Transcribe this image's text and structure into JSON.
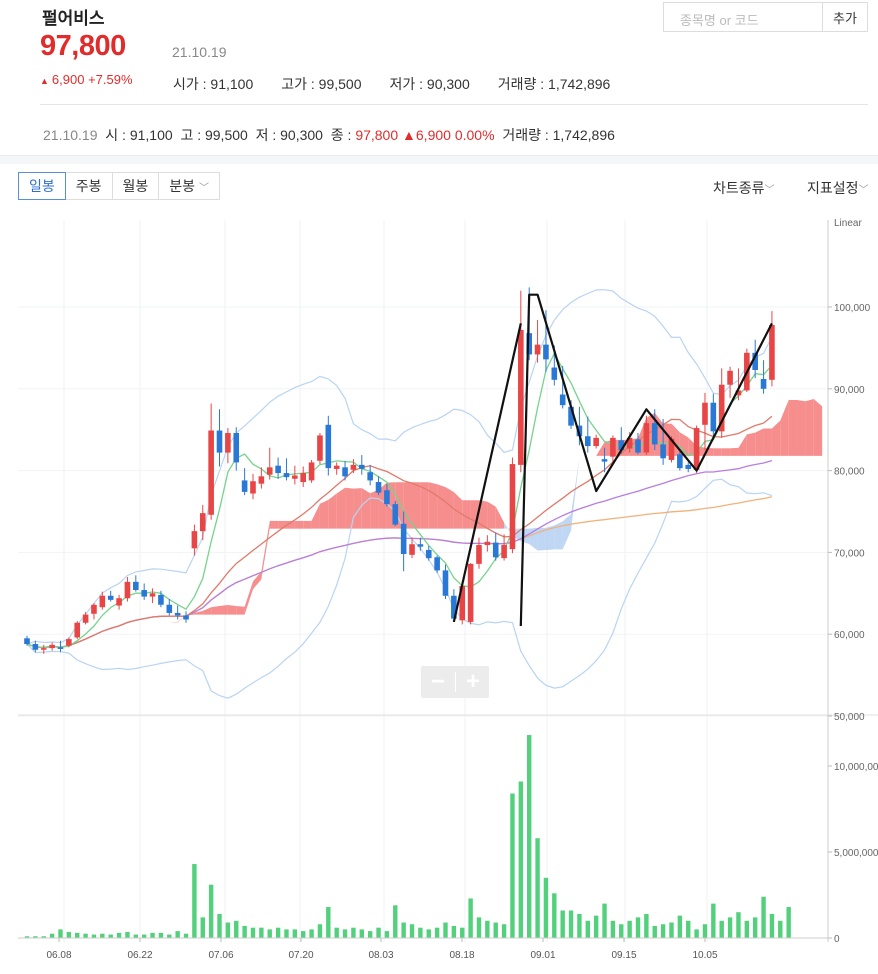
{
  "stock": {
    "name": "펄어비스",
    "price": "97,800",
    "date": "21.10.19",
    "change": "6,900",
    "change_pct": "+7.59%",
    "open_label": "시가 : 91,100",
    "high_label": "고가 : 99,500",
    "low_label": "저가 : 90,300",
    "volume_label": "거래량 : 1,742,896"
  },
  "search": {
    "placeholder": "종목명 or 코드",
    "add_label": "추가"
  },
  "info_line": {
    "date": "21.10.19",
    "open": "시 : 91,100",
    "high": "고 : 99,500",
    "low": "저 : 90,300",
    "close_label": "종 : ",
    "close": "97,800",
    "change": "6,900",
    "change_pct": "0.00%",
    "volume": "거래량 : 1,742,896"
  },
  "tabs": [
    "일봉",
    "주봉",
    "월봉",
    "분봉"
  ],
  "active_tab": "일봉",
  "options": {
    "chart_type": "차트종류",
    "indicator": "지표설정"
  },
  "colors": {
    "up": "#e84646",
    "down": "#2a78d6",
    "volume": "#52d07c",
    "cloud_up": "#f47a7a",
    "cloud_down": "#a9c8f0",
    "ma5": "#76d38c",
    "ma20": "#e07a6a",
    "ma60": "#b77ee0",
    "ma120": "#f0b27a",
    "accent": "#e12c2c"
  },
  "zoom": {
    "minus": "−",
    "plus": "+"
  },
  "chart_data": {
    "type": "candlestick",
    "price_axis": {
      "label": "Linear",
      "ylim": [
        50000,
        103000
      ],
      "ticks": [
        "100,000",
        "90,000",
        "80,000",
        "70,000",
        "60,000",
        "50,000"
      ]
    },
    "volume_axis": {
      "ylim": [
        0,
        13500000
      ],
      "ticks": [
        "10,000,000",
        "5,000,000",
        "0"
      ]
    },
    "x_ticks": [
      "06.08",
      "06.22",
      "07.06",
      "07.20",
      "08.03",
      "08.18",
      "09.01",
      "09.15",
      "10.05"
    ],
    "candles": [
      [
        59500,
        59800,
        58600,
        58800
      ],
      [
        58800,
        59200,
        57800,
        58100
      ],
      [
        58100,
        58700,
        57600,
        58300
      ],
      [
        58300,
        59000,
        58000,
        58700
      ],
      [
        58400,
        59200,
        57800,
        58200
      ],
      [
        58600,
        59600,
        58400,
        59400
      ],
      [
        59600,
        61600,
        59400,
        61400
      ],
      [
        61400,
        62700,
        61200,
        62400
      ],
      [
        62500,
        63800,
        61800,
        63600
      ],
      [
        63300,
        65200,
        63000,
        64700
      ],
      [
        64700,
        65300,
        64000,
        64200
      ],
      [
        63500,
        64800,
        63000,
        64400
      ],
      [
        64400,
        67000,
        64000,
        66400
      ],
      [
        66400,
        67200,
        65200,
        65400
      ],
      [
        65400,
        66200,
        64200,
        64600
      ],
      [
        64600,
        65600,
        63800,
        65000
      ],
      [
        64800,
        65300,
        63300,
        63600
      ],
      [
        63600,
        64300,
        62300,
        62600
      ],
      [
        62600,
        63500,
        61800,
        62300
      ],
      [
        62300,
        62800,
        61400,
        61800
      ],
      [
        70500,
        73400,
        69600,
        72600
      ],
      [
        72600,
        75800,
        71500,
        74800
      ],
      [
        74600,
        88200,
        74000,
        84900
      ],
      [
        84900,
        87500,
        80500,
        82200
      ],
      [
        82200,
        85200,
        80900,
        84600
      ],
      [
        84600,
        85300,
        80000,
        81000
      ],
      [
        78800,
        80300,
        77000,
        77400
      ],
      [
        77200,
        79600,
        76500,
        78700
      ],
      [
        78400,
        80400,
        77800,
        79300
      ],
      [
        79500,
        82800,
        78900,
        80400
      ],
      [
        80600,
        81600,
        79000,
        79700
      ],
      [
        79700,
        81500,
        78800,
        79200
      ],
      [
        79000,
        80600,
        78300,
        79400
      ],
      [
        78600,
        80500,
        78000,
        79700
      ],
      [
        78800,
        81300,
        78500,
        81000
      ],
      [
        81200,
        84600,
        80800,
        84300
      ],
      [
        85600,
        86700,
        79400,
        80300
      ],
      [
        80200,
        81000,
        79500,
        80600
      ],
      [
        80400,
        81200,
        78800,
        79300
      ],
      [
        80100,
        81400,
        79700,
        80700
      ],
      [
        80700,
        81900,
        79500,
        80200
      ],
      [
        79800,
        80700,
        78200,
        78800
      ],
      [
        78600,
        79300,
        77000,
        77300
      ],
      [
        77600,
        78400,
        75600,
        75900
      ],
      [
        75900,
        76300,
        73200,
        73400
      ],
      [
        73500,
        75000,
        67700,
        69800
      ],
      [
        69700,
        71800,
        69300,
        71000
      ],
      [
        71000,
        71800,
        70200,
        70700
      ],
      [
        70300,
        70800,
        69000,
        69300
      ],
      [
        69400,
        69600,
        67500,
        67800
      ],
      [
        67800,
        68500,
        64300,
        64700
      ],
      [
        64700,
        65500,
        61500,
        61900
      ],
      [
        61700,
        66500,
        61200,
        65900
      ],
      [
        61500,
        68700,
        61200,
        68600
      ],
      [
        68600,
        71800,
        68000,
        70900
      ],
      [
        70900,
        72100,
        70100,
        71300
      ],
      [
        71200,
        72400,
        69000,
        69400
      ],
      [
        69300,
        72200,
        69000,
        70900
      ],
      [
        70400,
        81600,
        69900,
        80800
      ],
      [
        80700,
        102000,
        79800,
        97200
      ],
      [
        96800,
        102400,
        93500,
        94200
      ],
      [
        94200,
        98400,
        93200,
        95400
      ],
      [
        95400,
        99600,
        92100,
        93600
      ],
      [
        92600,
        95300,
        90400,
        91100
      ],
      [
        89300,
        92800,
        87600,
        88000
      ],
      [
        87800,
        88600,
        85100,
        85500
      ],
      [
        85500,
        87800,
        83100,
        84200
      ],
      [
        84200,
        86600,
        82200,
        83000
      ],
      [
        83000,
        84400,
        82700,
        84000
      ],
      [
        81400,
        82800,
        79800,
        81100
      ],
      [
        81700,
        84300,
        80900,
        84000
      ],
      [
        83700,
        85300,
        82100,
        82500
      ],
      [
        82700,
        84700,
        82200,
        84000
      ],
      [
        83800,
        84600,
        82000,
        82200
      ],
      [
        82200,
        86700,
        81900,
        85800
      ],
      [
        85800,
        87500,
        82500,
        83200
      ],
      [
        83200,
        86300,
        80700,
        81500
      ],
      [
        81300,
        84200,
        81000,
        83900
      ],
      [
        82000,
        82400,
        80000,
        80300
      ],
      [
        80700,
        81000,
        79800,
        80200
      ],
      [
        80100,
        85500,
        79700,
        85200
      ],
      [
        85600,
        89500,
        82500,
        88300
      ],
      [
        88300,
        89400,
        84000,
        84800
      ],
      [
        84800,
        92500,
        84000,
        90500
      ],
      [
        90500,
        92700,
        88900,
        92200
      ],
      [
        89200,
        92500,
        88600,
        89800
      ],
      [
        89800,
        94900,
        89600,
        94400
      ],
      [
        94400,
        96000,
        91300,
        92300
      ],
      [
        91200,
        93500,
        89400,
        90000
      ],
      [
        91100,
        99500,
        90300,
        97800
      ]
    ],
    "volumes": [
      0.1,
      0.1,
      0.1,
      0.25,
      0.5,
      0.35,
      0.3,
      0.25,
      0.2,
      0.25,
      0.2,
      0.3,
      0.35,
      0.2,
      0.2,
      0.3,
      0.3,
      0.2,
      0.4,
      0.25,
      4.3,
      1.2,
      3.1,
      1.4,
      0.9,
      1.0,
      0.7,
      0.6,
      0.6,
      0.5,
      0.6,
      0.5,
      0.5,
      0.4,
      0.5,
      0.8,
      1.8,
      0.6,
      0.5,
      0.6,
      0.5,
      0.4,
      0.6,
      0.4,
      1.9,
      0.9,
      0.8,
      0.6,
      0.5,
      0.6,
      0.9,
      0.7,
      0.6,
      2.3,
      1.2,
      1.0,
      0.9,
      0.8,
      8.4,
      9.1,
      11.8,
      5.8,
      3.5,
      2.6,
      1.6,
      1.6,
      1.4,
      1.0,
      1.3,
      2.0,
      1.0,
      0.8,
      1.0,
      1.2,
      1.4,
      0.7,
      0.8,
      0.9,
      1.3,
      1.0,
      0.5,
      0.8,
      2.0,
      1.0,
      1.2,
      1.5,
      1.0,
      1.2,
      2.4,
      1.4,
      1.0,
      1.8
    ],
    "annotation": "zigzag"
  }
}
